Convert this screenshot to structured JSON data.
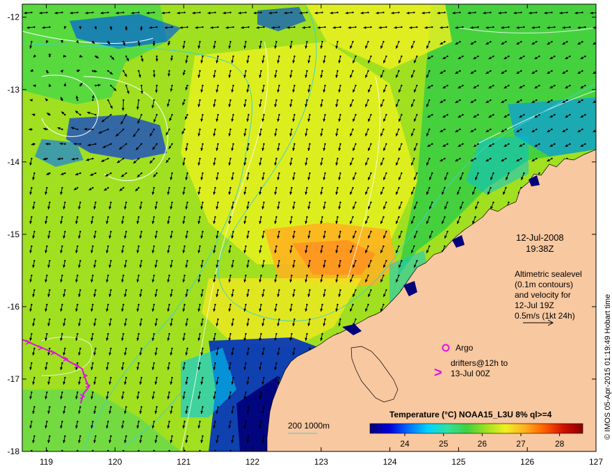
{
  "map": {
    "lon_ticks": [
      "119",
      "120",
      "121",
      "122",
      "123",
      "124",
      "125",
      "126",
      "127"
    ],
    "lat_ticks": [
      "-12",
      "-13",
      "-14",
      "-15",
      "-16",
      "-17",
      "-18"
    ],
    "lon_range": [
      118.65,
      127.0
    ],
    "lat_range": [
      -18.0,
      -11.82
    ]
  },
  "annotation": {
    "date": "12-Jul-2008",
    "time": "19:38Z",
    "altimetry_lines": [
      "Altimetric sealevel",
      "(0.1m contours)",
      "and velocity for",
      "12-Jul 19Z"
    ],
    "scale_label": "0.5m/s (1kt 24h)"
  },
  "legend": {
    "title": "Temperature (°C) NOAA15_L3U 8% ql>=4",
    "ticks": [
      "24",
      "25",
      "26",
      "27",
      "28"
    ],
    "tick_values": [
      24,
      25,
      26,
      27,
      28
    ],
    "range": [
      23.1,
      28.6
    ],
    "colors": [
      "#00007a",
      "#0000d8",
      "#0070ff",
      "#00d4ff",
      "#30e0a0",
      "#40d040",
      "#a0e020",
      "#f0f020",
      "#ffb020",
      "#ff6000",
      "#d01000",
      "#8a0000"
    ]
  },
  "bathymetry_label": "200  1000m",
  "markers": {
    "argo_label": "Argo",
    "drifter_symbol": ">",
    "drifter_label_1": "drifters@12h to",
    "drifter_label_2": "13-Jul 00Z"
  },
  "credit": "© IMOS 05-Apr-2015 01:19:49 Hobart time",
  "colors": {
    "land": "#f8c8a0",
    "arrow": "#000000",
    "isobath": "#40d0d0",
    "contour": "#ffffff",
    "marker": "#e010e0"
  }
}
